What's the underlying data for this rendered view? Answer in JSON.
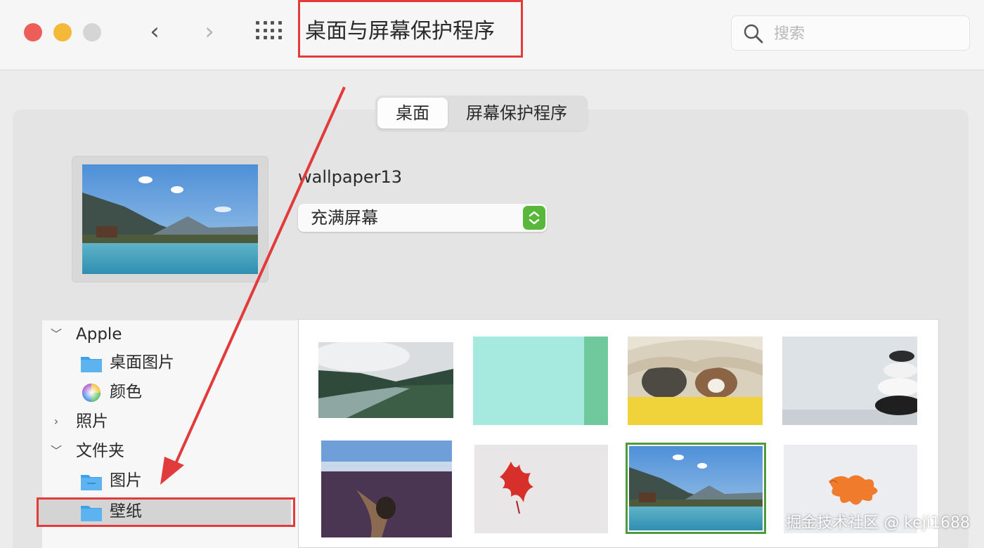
{
  "window": {
    "title": "桌面与屏幕保护程序",
    "search_placeholder": "搜索",
    "back_glyph": "‹",
    "forward_glyph": "›"
  },
  "tabs": [
    {
      "label": "桌面",
      "active": true
    },
    {
      "label": "屏幕保护程序",
      "active": false
    }
  ],
  "current_wallpaper": {
    "name": "wallpaper13",
    "fill_mode": "充满屏幕"
  },
  "sidebar": {
    "groups": [
      {
        "label": "Apple",
        "expanded": true,
        "items": [
          {
            "label": "桌面图片",
            "icon": "folder-icon"
          },
          {
            "label": "颜色",
            "icon": "color-wheel-icon"
          }
        ]
      },
      {
        "label": "照片",
        "expanded": false,
        "items": []
      },
      {
        "label": "文件夹",
        "expanded": true,
        "items": [
          {
            "label": "图片",
            "icon": "folder-icon"
          },
          {
            "label": "壁纸",
            "icon": "folder-icon"
          }
        ]
      }
    ]
  },
  "gallery": {
    "thumbnails": [
      {
        "desc": "river-valley"
      },
      {
        "desc": "mint-green"
      },
      {
        "desc": "dogs-blanket"
      },
      {
        "desc": "stacked-stones"
      },
      {
        "desc": "purple-lake"
      },
      {
        "desc": "red-leaf"
      },
      {
        "desc": "mountain-lake",
        "selected": true
      },
      {
        "desc": "orange-leaf"
      }
    ]
  },
  "watermark": "掘金技术社区 @ keji1688",
  "colors": {
    "accent_green": "#59b83b",
    "annotation_red": "#e23b3b",
    "selected_outline": "#4f9a3c"
  }
}
